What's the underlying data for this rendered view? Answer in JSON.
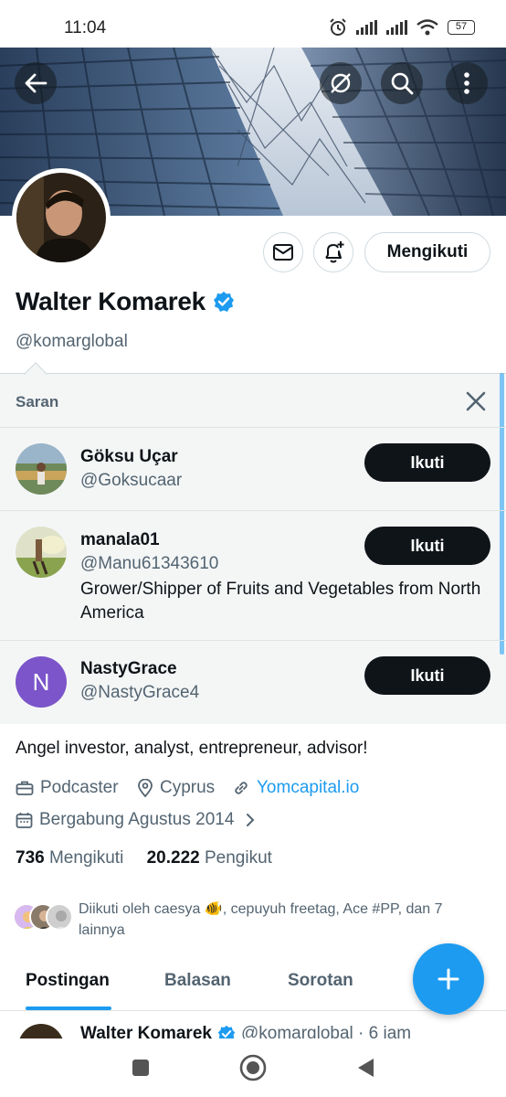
{
  "status": {
    "time": "11:04",
    "battery": "57"
  },
  "profile": {
    "name": "Walter Komarek",
    "handle": "@komarglobal",
    "follow_state": "Mengikuti",
    "bio": "Angel investor, analyst, entrepreneur, advisor!",
    "category": "Podcaster",
    "location": "Cyprus",
    "website": "Yomcapital.io",
    "joined": "Bergabung Agustus 2014",
    "following_count": "736",
    "following_label": "Mengikuti",
    "followers_count": "20.222",
    "followers_label": "Pengikut",
    "followed_by": "Diikuti oleh caesya 🐠, cepuyuh freetag, Ace #PP, dan 7 lainnya"
  },
  "suggestions": {
    "title": "Saran",
    "items": [
      {
        "name": "Göksu Uçar",
        "handle": "@Goksucaar",
        "bio": "",
        "button": "Ikuti"
      },
      {
        "name": "manala01",
        "handle": "@Manu61343610",
        "bio": "Grower/Shipper of Fruits and Vegetables from North America",
        "button": "Ikuti"
      },
      {
        "name": "NastyGrace",
        "handle": "@NastyGrace4",
        "initial": "N",
        "bio": "",
        "button": "Ikuti"
      }
    ]
  },
  "tabs": [
    "Postingan",
    "Balasan",
    "Sorotan"
  ],
  "post_peek": {
    "name": "Walter Komarek",
    "handle": "@komarglobal · 6 jam"
  },
  "colors": {
    "accent": "#1d9bf0",
    "text": "#0f1419",
    "secondary": "#536471",
    "button_dark": "#0f1419",
    "avatar_purple": "#7b55c9"
  },
  "icons": [
    "back-arrow-icon",
    "grok-icon",
    "search-icon",
    "more-icon",
    "mail-icon",
    "bell-plus-icon",
    "verified-icon",
    "close-icon",
    "briefcase-icon",
    "location-icon",
    "link-icon",
    "calendar-icon",
    "chevron-right-icon",
    "plus-icon"
  ]
}
